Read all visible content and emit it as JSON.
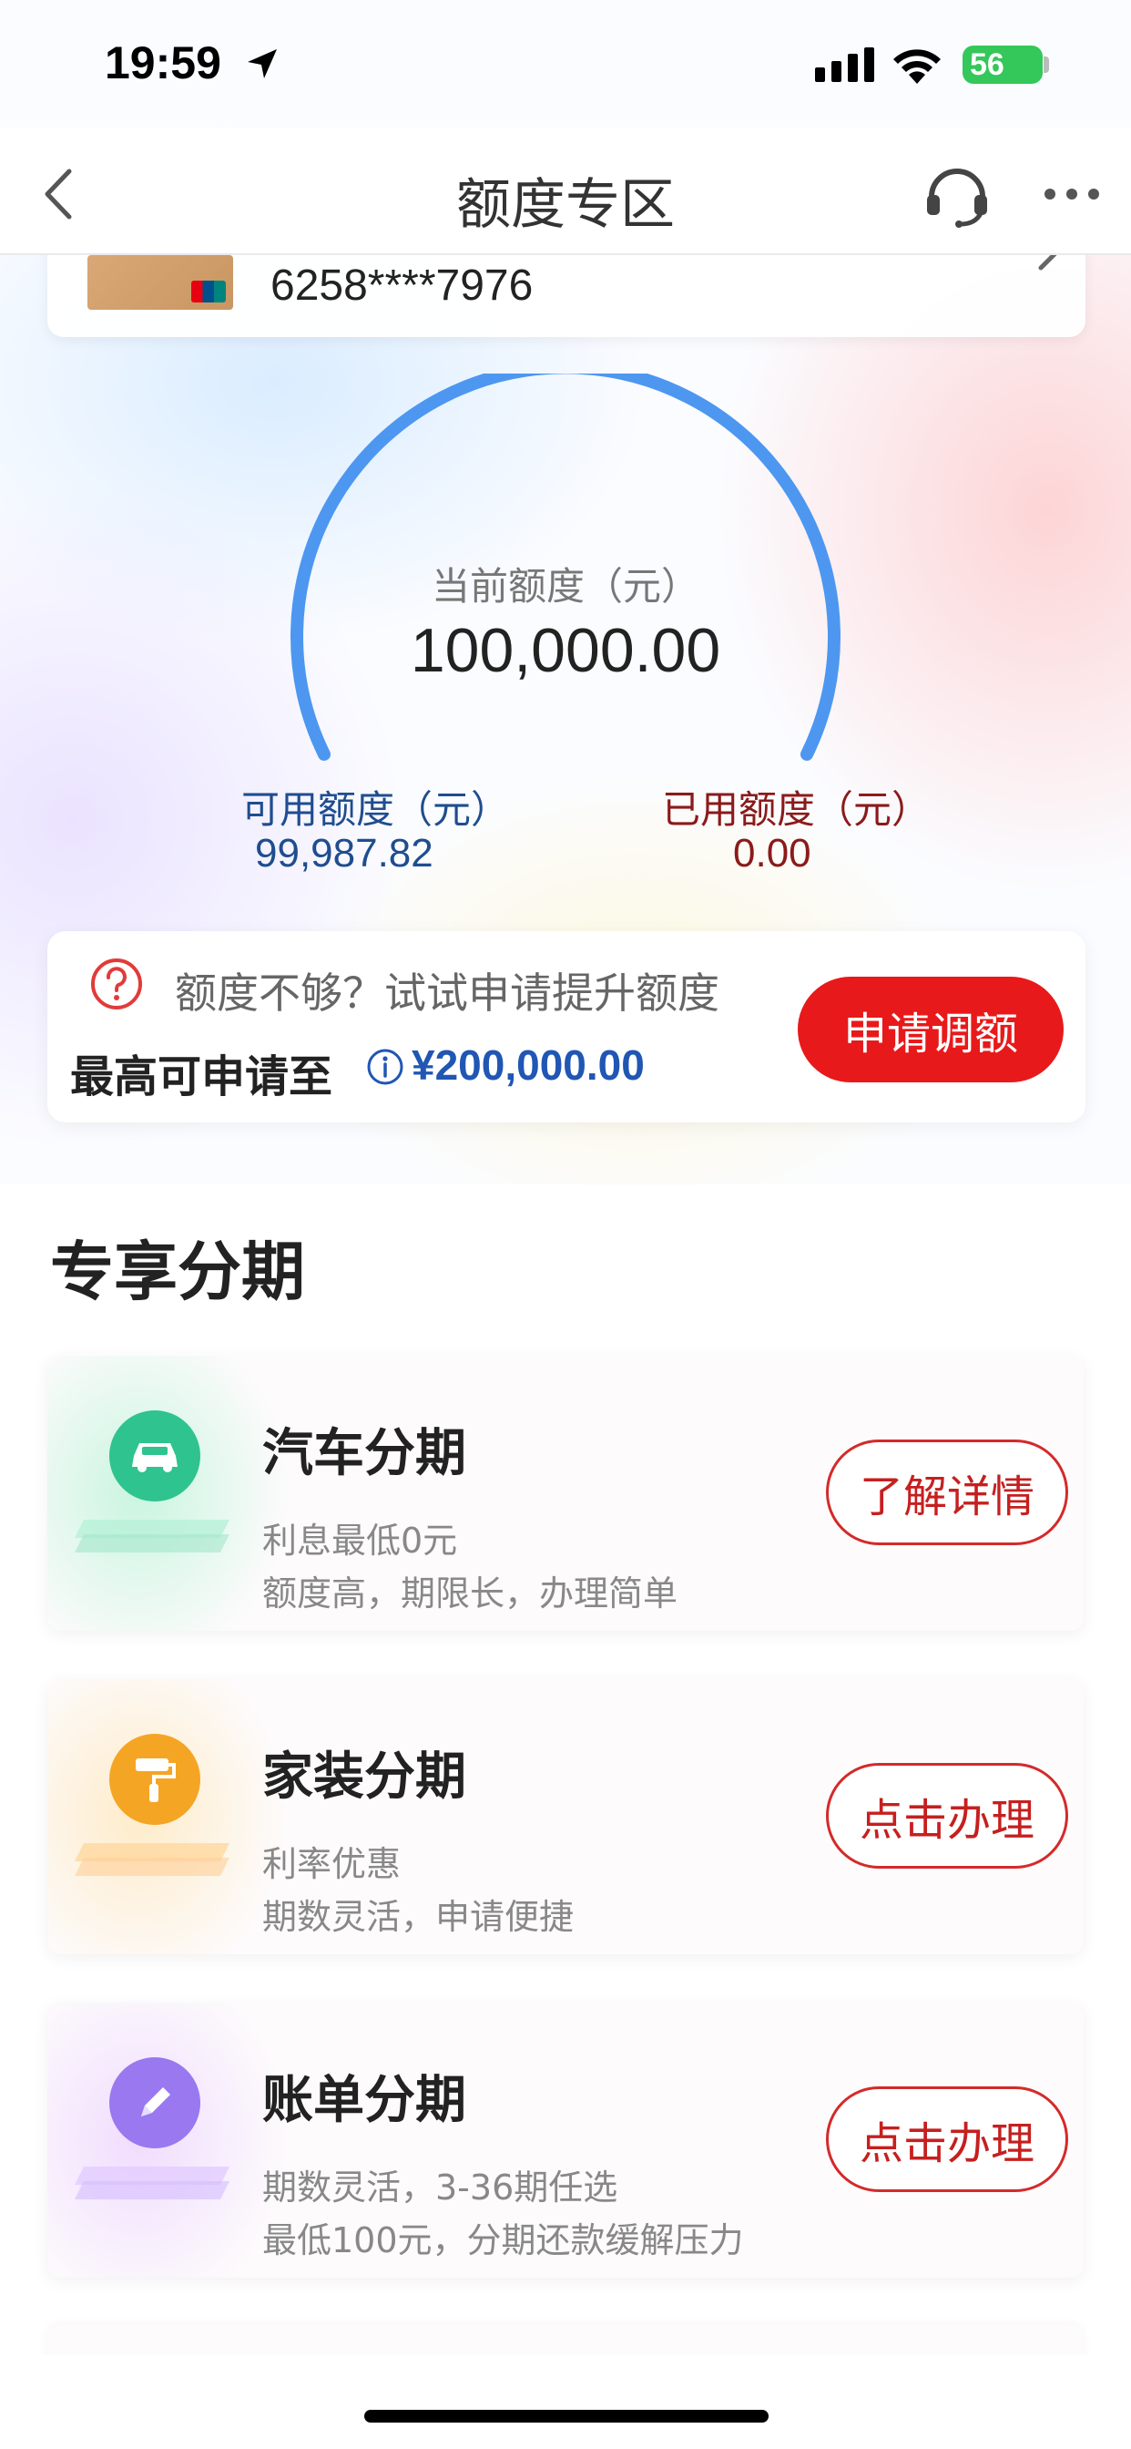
{
  "status_bar": {
    "time": "19:59",
    "battery": "56"
  },
  "nav": {
    "title": "额度专区"
  },
  "card": {
    "number": "6258****7976"
  },
  "limit": {
    "current_label": "当前额度（元）",
    "current_value": "100,000.00",
    "available_label": "可用额度（元）",
    "available_value": "99,987.82",
    "used_label": "已用额度（元）",
    "used_value": "0.00"
  },
  "promo": {
    "text": "额度不够？试试申请提升额度",
    "max_label": "最高可申请至",
    "max_value": "¥200,000.00",
    "button": "申请调额"
  },
  "section": {
    "title": "专享分期"
  },
  "items": [
    {
      "title": "汽车分期",
      "line1": "利息最低0元",
      "line2": "额度高，期限长，办理简单",
      "button": "了解详情",
      "icon": "car-icon",
      "color": "#2fc38f"
    },
    {
      "title": "家装分期",
      "line1": "利率优惠",
      "line2": "期数灵活，申请便捷",
      "button": "点击办理",
      "icon": "paint-roller-icon",
      "color": "#f5a524"
    },
    {
      "title": "账单分期",
      "line1": "期数灵活，3-36期任选",
      "line2": "最低100元，分期还款缓解压力",
      "button": "点击办理",
      "icon": "pencil-icon",
      "color": "#9a78f0"
    }
  ],
  "colors": {
    "accent_red": "#e8191a",
    "gauge_blue": "#4d97f0",
    "link_blue": "#2056b4"
  }
}
